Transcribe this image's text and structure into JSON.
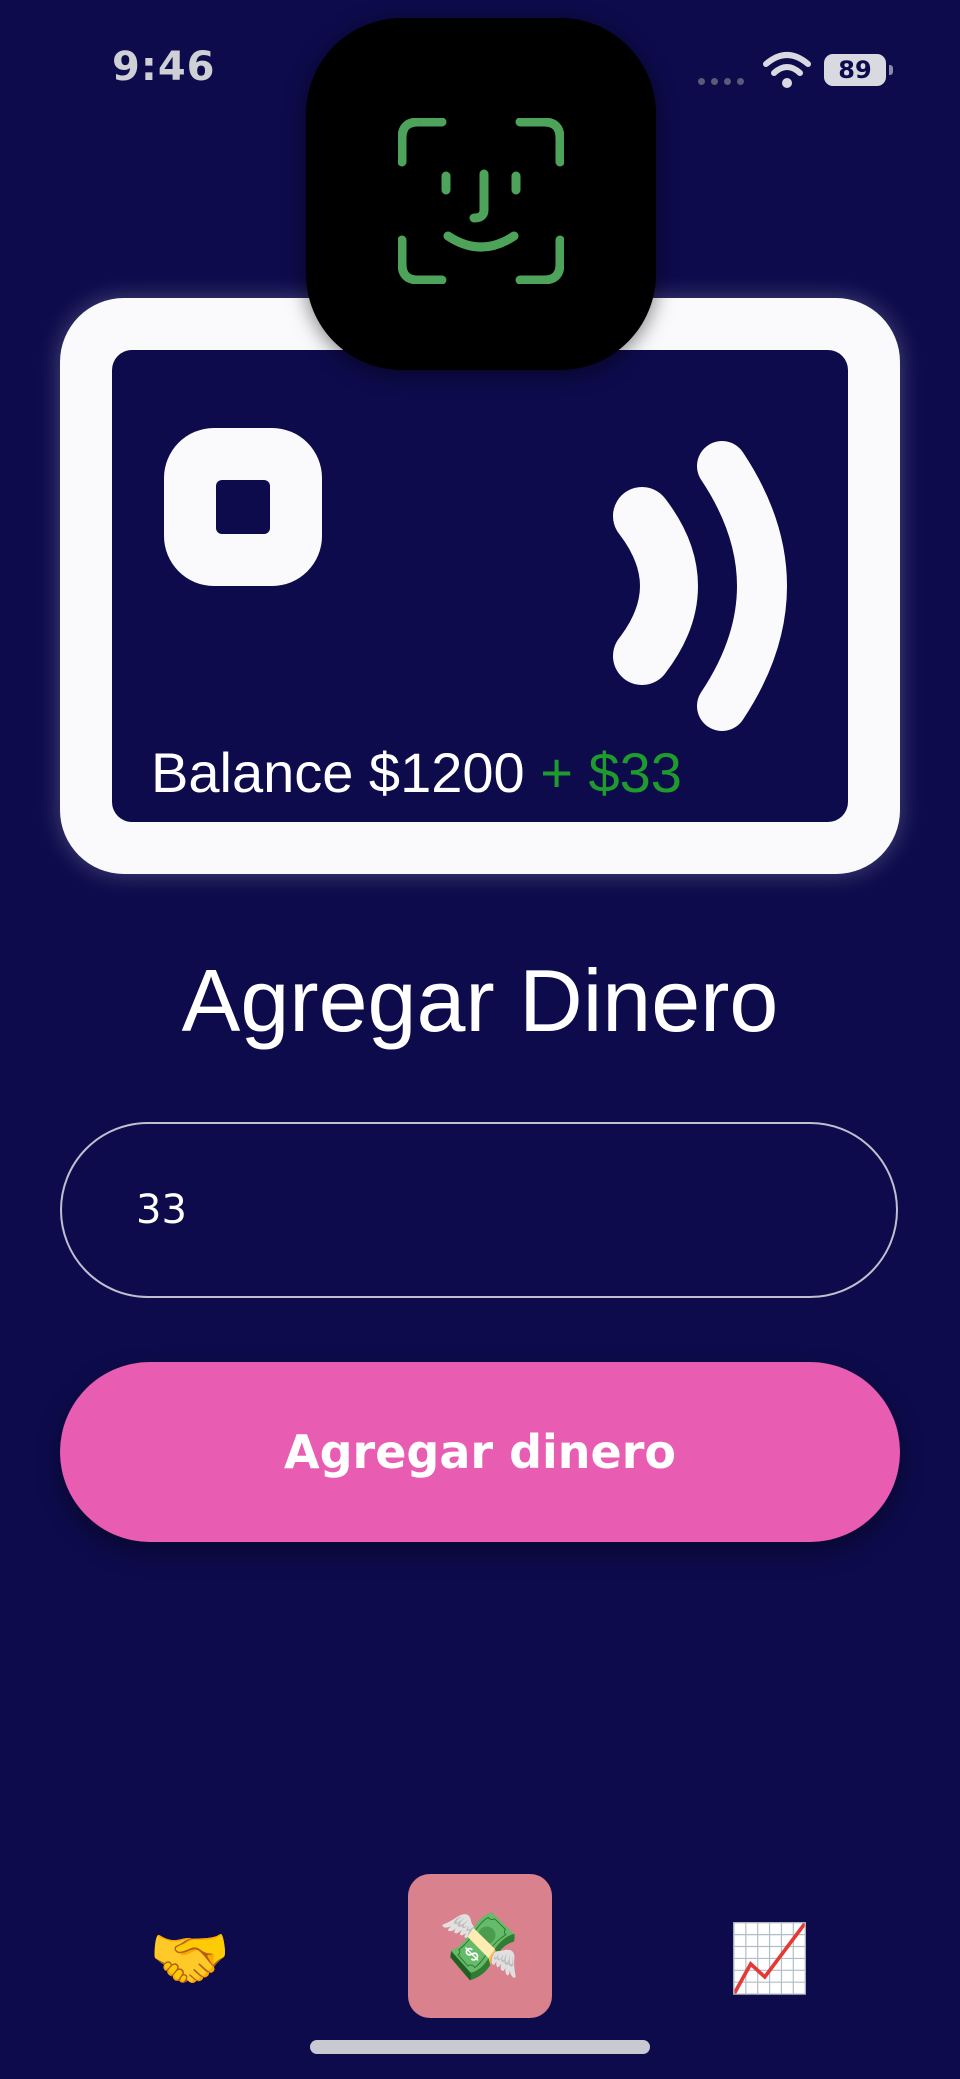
{
  "status_bar": {
    "time": "9:46",
    "battery": "89"
  },
  "card": {
    "balance_label": "Balance $1200",
    "added_label": " + $33"
  },
  "title": "Agregar Dinero",
  "amount_input": {
    "value": "33"
  },
  "add_button": {
    "label": "Agregar dinero"
  },
  "tab_bar": {
    "tabs": [
      {
        "icon": "🤝",
        "icon_name": "handshake-icon"
      },
      {
        "icon": "💸",
        "icon_name": "money-with-wings-icon",
        "selected": true
      },
      {
        "icon": "📈",
        "icon_name": "chart-increasing-icon"
      }
    ]
  },
  "colors": {
    "background": "#0d0b4b",
    "accent_button": "#e85db2",
    "added_amount": "#1f9a2c",
    "selected_tab": "#d9818c",
    "faceid": "#4ea35a"
  }
}
